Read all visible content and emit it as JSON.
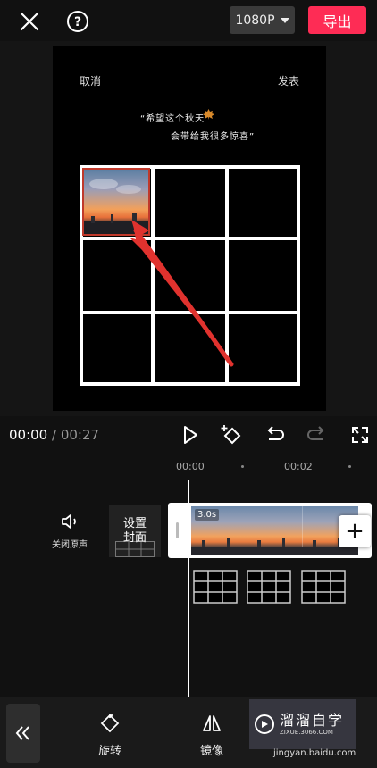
{
  "topbar": {
    "resolution": "1080P",
    "export_label": "导出"
  },
  "preview": {
    "cancel": "取消",
    "publish": "发表",
    "quote_line1": "“希望这个秋天",
    "quote_line2": "会带给我很多惊喜”"
  },
  "playback": {
    "current_time": "00:00",
    "separator": " / ",
    "total_time": "00:27"
  },
  "timeline": {
    "ruler_labels": [
      "00:00",
      "00:02"
    ],
    "mute_label": "关闭原声",
    "cover_label_line1": "设置",
    "cover_label_line2": "封面",
    "clip_duration": "3.0s",
    "add_label": "+"
  },
  "toolbar": {
    "items": [
      {
        "label": "旋转",
        "icon": "rotate-icon"
      },
      {
        "label": "镜像",
        "icon": "mirror-icon"
      }
    ]
  },
  "watermark": {
    "title": "溜溜自学",
    "subtitle": "ZIXUE.3066.COM",
    "url": "jingyan.baidu.com"
  },
  "colors": {
    "accent": "#fe2c55",
    "background": "#111111",
    "highlight_border": "#c0392b"
  }
}
